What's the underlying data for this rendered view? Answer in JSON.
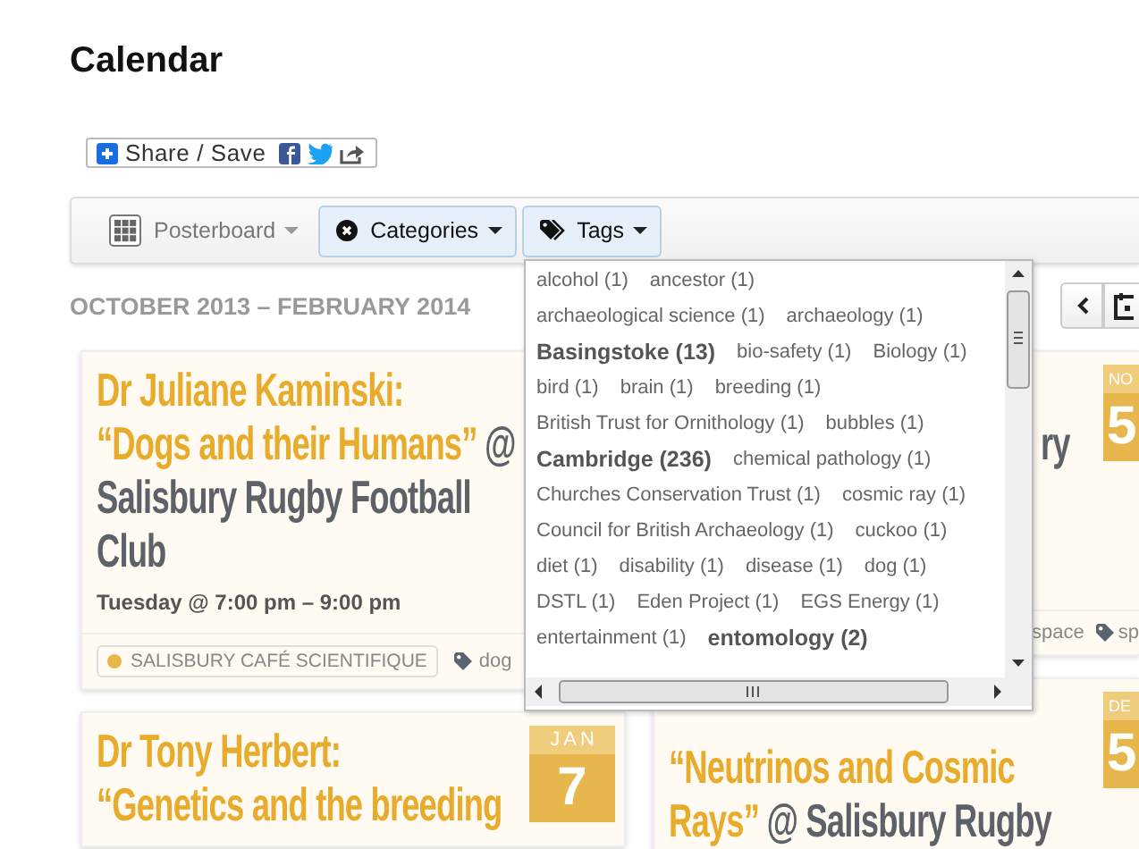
{
  "page": {
    "title": "Calendar"
  },
  "share": {
    "label": "Share / Save"
  },
  "toolbar": [
    {
      "kind": "view",
      "label": "Posterboard",
      "selected": false
    },
    {
      "kind": "categories",
      "label": "Categories",
      "selected": true
    },
    {
      "kind": "tags",
      "label": "Tags",
      "selected": true
    }
  ],
  "date_range": "OCTOBER 2013 – FEBRUARY 2014",
  "tags_menu": [
    {
      "text": "alcohol (1)",
      "kind": "normal"
    },
    {
      "text": "ancestor (1)",
      "kind": "normal"
    },
    {
      "text": "archaeological science (1)",
      "kind": "normal"
    },
    {
      "text": "archaeology (1)",
      "kind": "normal"
    },
    {
      "text": "Basingstoke (13)",
      "kind": "major"
    },
    {
      "text": "bio-safety (1)",
      "kind": "normal"
    },
    {
      "text": "Biology (1)",
      "kind": "normal"
    },
    {
      "text": "bird (1)",
      "kind": "normal"
    },
    {
      "text": "brain (1)",
      "kind": "normal"
    },
    {
      "text": "breeding (1)",
      "kind": "normal"
    },
    {
      "text": "British Trust for Ornithology (1)",
      "kind": "normal"
    },
    {
      "text": "bubbles (1)",
      "kind": "normal"
    },
    {
      "text": "Cambridge (236)",
      "kind": "major"
    },
    {
      "text": "chemical pathology (1)",
      "kind": "normal"
    },
    {
      "text": "Churches Conservation Trust (1)",
      "kind": "normal"
    },
    {
      "text": "cosmic ray (1)",
      "kind": "normal"
    },
    {
      "text": "Council for British Archaeology (1)",
      "kind": "normal"
    },
    {
      "text": "cuckoo (1)",
      "kind": "normal"
    },
    {
      "text": "diet (1)",
      "kind": "normal"
    },
    {
      "text": "disability (1)",
      "kind": "normal"
    },
    {
      "text": "disease (1)",
      "kind": "normal"
    },
    {
      "text": "dog (1)",
      "kind": "normal"
    },
    {
      "text": "DSTL (1)",
      "kind": "normal"
    },
    {
      "text": "Eden Project (1)",
      "kind": "normal"
    },
    {
      "text": "EGS Energy (1)",
      "kind": "normal"
    },
    {
      "text": "entertainment (1)",
      "kind": "normal"
    },
    {
      "text": "entomology (2)",
      "kind": "major"
    }
  ],
  "columns": [
    [
      {
        "title_lines": [
          [
            {
              "kind": "link",
              "text": "Dr Juliane Kaminski:"
            }
          ],
          [
            {
              "kind": "link",
              "text": "“Dogs and their Humans”"
            },
            {
              "kind": "venue",
              "text": "@"
            }
          ],
          [
            {
              "kind": "venue",
              "text": "Salisbury Rugby Football"
            }
          ],
          [
            {
              "kind": "venue",
              "text": "Club"
            }
          ]
        ],
        "time": "Tuesday @ 7:00 pm – 9:00 pm",
        "footer": [
          {
            "kind": "category",
            "text": "SALISBURY CAFÉ SCIENTIFIQUE",
            "color": "#e6b84c"
          },
          {
            "kind": "tag",
            "text": "dog"
          }
        ]
      },
      {
        "title_lines": [
          [
            {
              "kind": "link",
              "text": "Dr Tony Herbert:"
            }
          ],
          [
            {
              "kind": "link",
              "text": "“Genetics and the breeding"
            }
          ]
        ],
        "month": "JAN",
        "day": "7"
      }
    ],
    [
      {
        "title_lines": [
          [
            {
              "kind": "venue",
              "text": "ry"
            }
          ]
        ],
        "month": "NO",
        "day": "5",
        "footer": [
          {
            "kind": "text",
            "text": "space"
          },
          {
            "kind": "tag",
            "text": "sp"
          }
        ]
      },
      {
        "title_lines": [
          [
            {
              "kind": "link",
              "text": "“Neutrinos and Cosmic"
            }
          ],
          [
            {
              "kind": "link",
              "text": "Rays”"
            },
            {
              "kind": "venue",
              "text": "@ Salisbury Rugby"
            }
          ]
        ],
        "month": "DE",
        "day": "5"
      }
    ]
  ]
}
